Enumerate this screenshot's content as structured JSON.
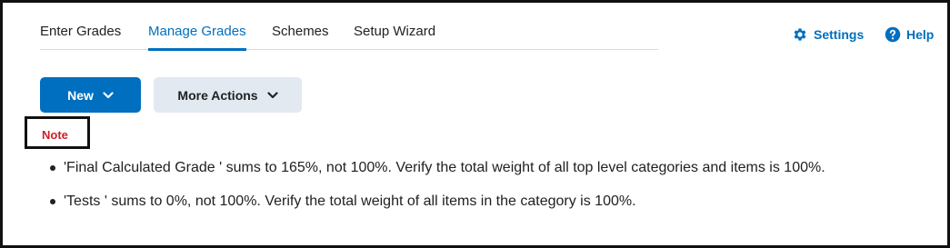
{
  "nav": {
    "tabs": [
      {
        "label": "Enter Grades",
        "active": false
      },
      {
        "label": "Manage Grades",
        "active": true
      },
      {
        "label": "Schemes",
        "active": false
      },
      {
        "label": "Setup Wizard",
        "active": false
      }
    ],
    "settings_label": "Settings",
    "help_label": "Help",
    "settings_icon": "gear-icon",
    "help_icon": "help-circle-icon"
  },
  "toolbar": {
    "new_label": "New",
    "more_actions_label": "More Actions"
  },
  "note": {
    "label": "Note",
    "items": [
      "'Final Calculated Grade ' sums to 165%, not 100%. Verify the total weight of all top level categories and items is 100%.",
      "'Tests ' sums to 0%, not 100%. Verify the total weight of all items in the category is 100%."
    ]
  },
  "colors": {
    "accent": "#006fbf",
    "note_red": "#cd2026",
    "secondary_button": "#e3e9f1"
  }
}
